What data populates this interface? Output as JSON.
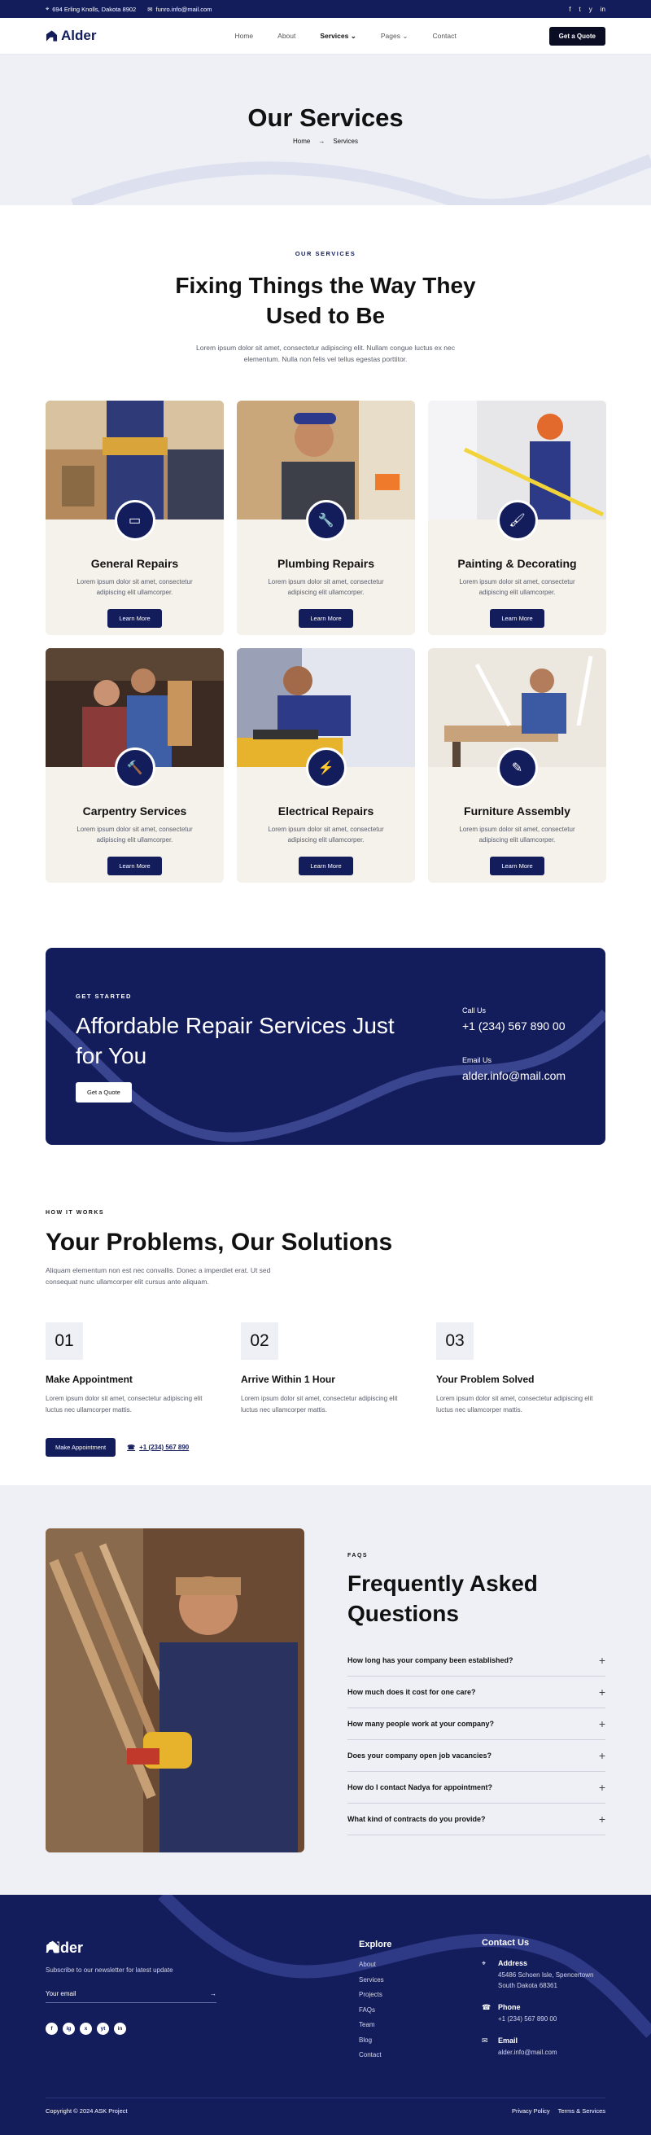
{
  "topbar": {
    "address": "694 Erling Knolls, Dakota 8902",
    "email": "funro.info@mail.com",
    "socials": [
      "f",
      "t",
      "y",
      "in"
    ]
  },
  "nav": {
    "brand": "Alder",
    "links": [
      "Home",
      "About",
      "Services",
      "Pages",
      "Contact"
    ],
    "active": "Services",
    "cta": "Get a Quote"
  },
  "hero": {
    "title": "Our Services",
    "crumb_home": "Home",
    "crumb_current": "Services"
  },
  "services": {
    "eyebrow": "OUR SERVICES",
    "title": "Fixing Things the Way They Used to Be",
    "desc": "Lorem ipsum dolor sit amet, consectetur adipiscing elit. Nullam congue luctus ex nec elementum. Nulla non felis vel tellus egestas porttitor.",
    "cards": [
      {
        "title": "General Repairs",
        "text": "Lorem ipsum dolor sit amet, consectetur adipiscing elit ullamcorper.",
        "button": "Learn More",
        "icon": "toolbox-icon"
      },
      {
        "title": "Plumbing Repairs",
        "text": "Lorem ipsum dolor sit amet, consectetur adipiscing elit ullamcorper.",
        "button": "Learn More",
        "icon": "wrench-icon"
      },
      {
        "title": "Painting & Decorating",
        "text": "Lorem ipsum dolor sit amet, consectetur adipiscing elit ullamcorper.",
        "button": "Learn More",
        "icon": "paint-roller-icon"
      },
      {
        "title": "Carpentry Services",
        "text": "Lorem ipsum dolor sit amet, consectetur adipiscing elit ullamcorper.",
        "button": "Learn More",
        "icon": "hammer-icon"
      },
      {
        "title": "Electrical Repairs",
        "text": "Lorem ipsum dolor sit amet, consectetur adipiscing elit ullamcorper.",
        "button": "Learn More",
        "icon": "drill-icon"
      },
      {
        "title": "Furniture Assembly",
        "text": "Lorem ipsum dolor sit amet, consectetur adipiscing elit ullamcorper.",
        "button": "Learn More",
        "icon": "brush-icon"
      }
    ]
  },
  "cta": {
    "eyebrow": "GET STARTED",
    "title": "Affordable Repair Services Just for You",
    "button": "Get a Quote",
    "call_label": "Call Us",
    "call_value": "+1 (234) 567 890 00",
    "email_label": "Email Us",
    "email_value": "alder.info@mail.com"
  },
  "how": {
    "eyebrow": "HOW IT WORKS",
    "title": "Your Problems, Our Solutions",
    "desc": "Aliquam elementum non est nec convallis. Donec a imperdiet erat. Ut sed consequat nunc ullamcorper elit cursus ante aliquam.",
    "steps": [
      {
        "num": "01",
        "title": "Make Appointment",
        "text": "Lorem ipsum dolor sit amet, consectetur adipiscing elit luctus nec ullamcorper mattis."
      },
      {
        "num": "02",
        "title": "Arrive Within 1 Hour",
        "text": "Lorem ipsum dolor sit amet, consectetur adipiscing elit luctus nec ullamcorper mattis."
      },
      {
        "num": "03",
        "title": "Your Problem Solved",
        "text": "Lorem ipsum dolor sit amet, consectetur adipiscing elit luctus nec ullamcorper mattis."
      }
    ],
    "button": "Make Appointment",
    "phone": "+1 (234) 567 890"
  },
  "faq": {
    "eyebrow": "FAQS",
    "title": "Frequently Asked Questions",
    "items": [
      "How long has your company been established?",
      "How much does it cost for one care?",
      "How many people work at your company?",
      "Does your company open job vacancies?",
      "How do I contact Nadya for appointment?",
      "What kind of contracts do you provide?"
    ]
  },
  "footer": {
    "brand": "Alder",
    "subscribe": "Subscribe to our newsletter for latest update",
    "email_placeholder": "Your email",
    "socials": [
      "f",
      "ig",
      "x",
      "yt",
      "in"
    ],
    "explore_title": "Explore",
    "explore": [
      "About",
      "Services",
      "Projects",
      "FAQs",
      "Team",
      "Blog",
      "Contact"
    ],
    "contact_title": "Contact Us",
    "address_label": "Address",
    "address": "45486 Schoen Isle, Spencertown South Dakota 68361",
    "phone_label": "Phone",
    "phone": "+1 (234) 567 890 00",
    "email_label": "Email",
    "email": "alder.info@mail.com",
    "copyright": "Copyright © 2024 ASK Project",
    "privacy": "Privacy Policy",
    "terms": "Terms & Services"
  },
  "colors": {
    "navy": "#141d5c",
    "light": "#eef0f6",
    "beige": "#f5f2ec"
  }
}
